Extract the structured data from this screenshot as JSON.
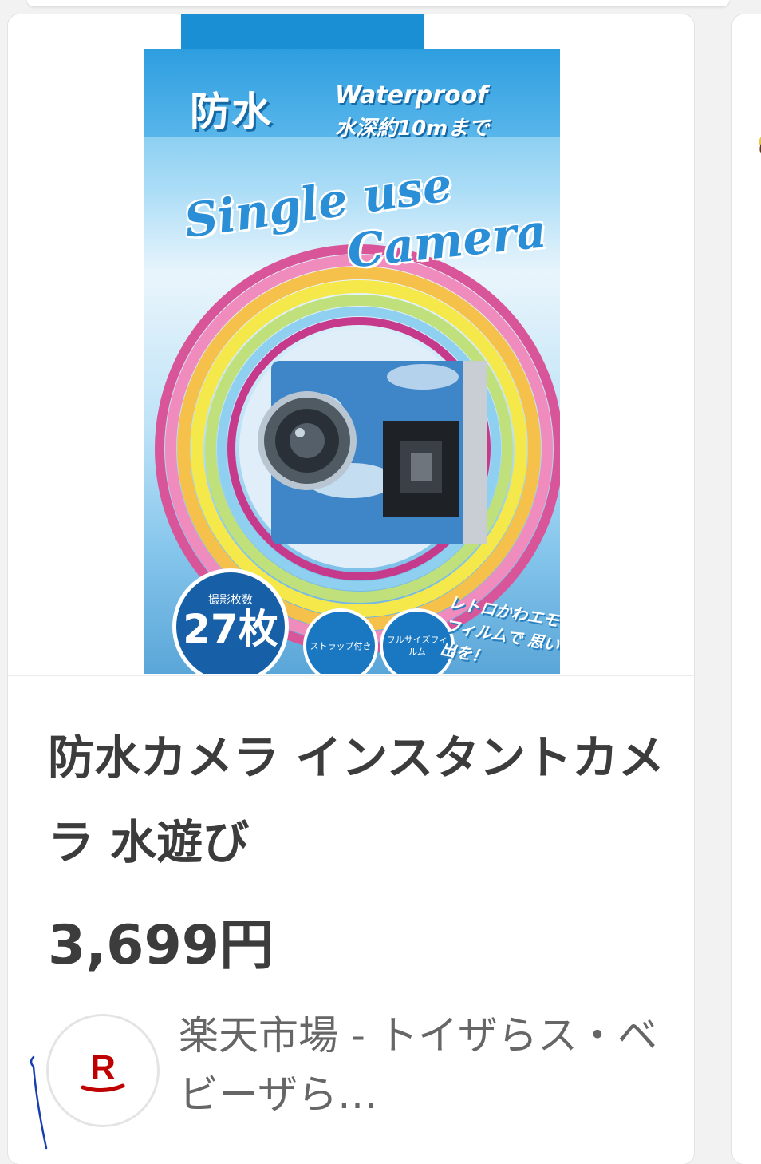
{
  "product": {
    "title": "防水カメラ インスタントカメラ 水遊び",
    "price": "3,699円",
    "seller": "楽天市場 - トイザらス・ベビーザら…"
  },
  "product_image": {
    "label_waterproof_jp": "防水",
    "label_waterproof_en": "Waterproof",
    "label_depth": "水深約10mまで",
    "script_line1": "Single use",
    "script_line2": "Camera",
    "badge_shots_label": "撮影枚数",
    "badge_shots_value": "27枚",
    "badge_strap": "ストラップ付き",
    "badge_film": "フルサイズフィルム",
    "retro_text": "レトロかわエモい フィルムで 思い出を！"
  },
  "seller_icon": "rakuten-r-icon",
  "colors": {
    "title_text": "#3c3c3c",
    "seller_text": "#666666",
    "rakuten_red": "#bf0000",
    "box_blue": "#1a8fd3"
  }
}
